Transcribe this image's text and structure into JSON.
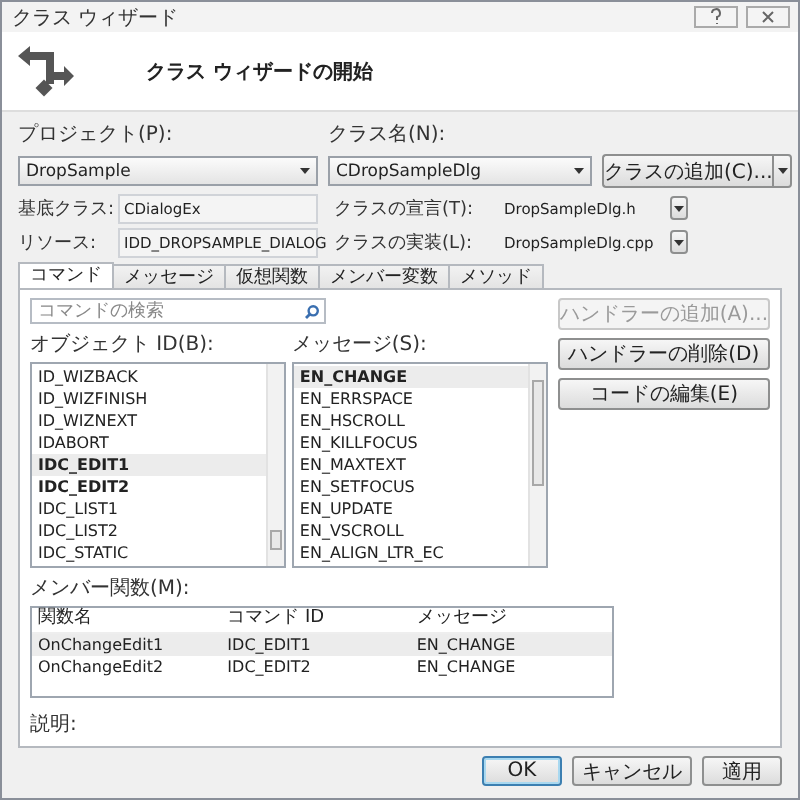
{
  "window": {
    "title": "クラス ウィザード"
  },
  "header": {
    "title": "クラス ウィザードの開始"
  },
  "project": {
    "label": "プロジェクト(P):",
    "value": "DropSample"
  },
  "class_name": {
    "label": "クラス名(N):",
    "value": "CDropSampleDlg"
  },
  "add_class_button": "クラスの追加(C)...",
  "base_class": {
    "label": "基底クラス:",
    "value": "CDialogEx"
  },
  "class_declaration": {
    "label": "クラスの宣言(T):",
    "value": "DropSampleDlg.h"
  },
  "resource": {
    "label": "リソース:",
    "value": "IDD_DROPSAMPLE_DIALOG"
  },
  "class_implementation": {
    "label": "クラスの実装(L):",
    "value": "DropSampleDlg.cpp"
  },
  "tabs": [
    {
      "label": "コマンド",
      "selected": true
    },
    {
      "label": "メッセージ",
      "selected": false
    },
    {
      "label": "仮想関数",
      "selected": false
    },
    {
      "label": "メンバー変数",
      "selected": false
    },
    {
      "label": "メソッド",
      "selected": false
    }
  ],
  "search": {
    "placeholder": "コマンドの検索"
  },
  "object_ids": {
    "label": "オブジェクト ID(B):",
    "items": [
      {
        "text": "ID_WIZBACK",
        "bold": false,
        "selected": false
      },
      {
        "text": "ID_WIZFINISH",
        "bold": false,
        "selected": false
      },
      {
        "text": "ID_WIZNEXT",
        "bold": false,
        "selected": false
      },
      {
        "text": "IDABORT",
        "bold": false,
        "selected": false
      },
      {
        "text": "IDC_EDIT1",
        "bold": true,
        "selected": true
      },
      {
        "text": "IDC_EDIT2",
        "bold": true,
        "selected": false
      },
      {
        "text": "IDC_LIST1",
        "bold": false,
        "selected": false
      },
      {
        "text": "IDC_LIST2",
        "bold": false,
        "selected": false
      },
      {
        "text": "IDC_STATIC",
        "bold": false,
        "selected": false
      }
    ]
  },
  "messages": {
    "label": "メッセージ(S):",
    "items": [
      {
        "text": "EN_CHANGE",
        "bold": true,
        "selected": true
      },
      {
        "text": "EN_ERRSPACE",
        "bold": false,
        "selected": false
      },
      {
        "text": "EN_HSCROLL",
        "bold": false,
        "selected": false
      },
      {
        "text": "EN_KILLFOCUS",
        "bold": false,
        "selected": false
      },
      {
        "text": "EN_MAXTEXT",
        "bold": false,
        "selected": false
      },
      {
        "text": "EN_SETFOCUS",
        "bold": false,
        "selected": false
      },
      {
        "text": "EN_UPDATE",
        "bold": false,
        "selected": false
      },
      {
        "text": "EN_VSCROLL",
        "bold": false,
        "selected": false
      },
      {
        "text": "EN_ALIGN_LTR_EC",
        "bold": false,
        "selected": false
      }
    ]
  },
  "handler_buttons": [
    {
      "label": "ハンドラーの追加(A)...",
      "disabled": true
    },
    {
      "label": "ハンドラーの削除(D)",
      "disabled": false
    },
    {
      "label": "コードの編集(E)",
      "disabled": false
    }
  ],
  "member_functions": {
    "label": "メンバー関数(M):",
    "columns": [
      "関数名",
      "コマンド ID",
      "メッセージ"
    ],
    "rows": [
      {
        "cells": [
          "OnChangeEdit1",
          "IDC_EDIT1",
          "EN_CHANGE"
        ],
        "selected": true
      },
      {
        "cells": [
          "OnChangeEdit2",
          "IDC_EDIT2",
          "EN_CHANGE"
        ],
        "selected": false
      }
    ]
  },
  "description": {
    "label": "説明:"
  },
  "footer_buttons": [
    {
      "label": "OK",
      "default": true
    },
    {
      "label": "キャンセル",
      "default": false
    },
    {
      "label": "適用",
      "default": false
    }
  ]
}
